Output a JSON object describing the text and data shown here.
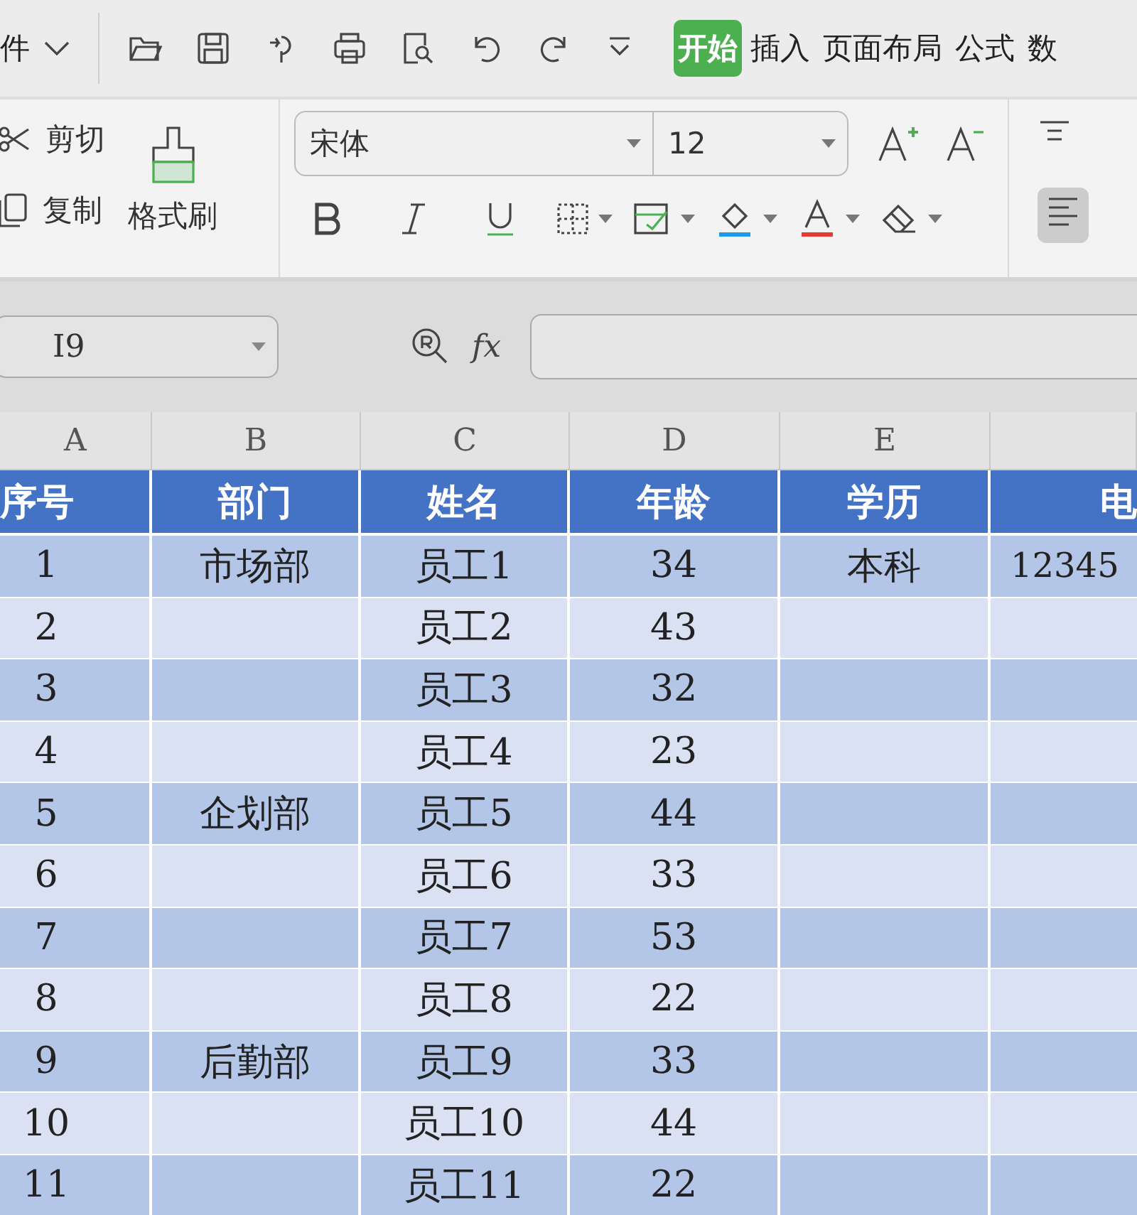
{
  "menu_bar": {
    "file_menu_fragment": "件",
    "tabs": [
      {
        "label": "开始",
        "selected": true
      },
      {
        "label": "插入",
        "selected": false
      },
      {
        "label": "页面布局",
        "selected": false
      },
      {
        "label": "公式",
        "selected": false
      },
      {
        "label": "数",
        "selected": false
      }
    ]
  },
  "ribbon": {
    "clipboard": [
      {
        "label": "剪切",
        "kind": "cut"
      },
      {
        "label": "复制",
        "kind": "copy"
      }
    ],
    "format_painter": "格式刷",
    "font_name": "宋体",
    "font_size": "12"
  },
  "formula_bar": {
    "cell_reference": "I9",
    "function_label": "fx"
  },
  "sheet": {
    "column_letters": [
      "A",
      "B",
      "C",
      "D",
      "E"
    ],
    "header": [
      "序号",
      "部门",
      "姓名",
      "年龄",
      "学历",
      "电"
    ],
    "rows": [
      [
        "1",
        "市场部",
        "员工1",
        "34",
        "本科",
        "12345"
      ],
      [
        "2",
        "",
        "员工2",
        "43",
        "",
        ""
      ],
      [
        "3",
        "",
        "员工3",
        "32",
        "",
        ""
      ],
      [
        "4",
        "",
        "员工4",
        "23",
        "",
        ""
      ],
      [
        "5",
        "企划部",
        "员工5",
        "44",
        "",
        ""
      ],
      [
        "6",
        "",
        "员工6",
        "33",
        "",
        ""
      ],
      [
        "7",
        "",
        "员工7",
        "53",
        "",
        ""
      ],
      [
        "8",
        "",
        "员工8",
        "22",
        "",
        ""
      ],
      [
        "9",
        "后勤部",
        "员工9",
        "33",
        "",
        ""
      ],
      [
        "10",
        "",
        "员工10",
        "44",
        "",
        ""
      ],
      [
        "11",
        "",
        "员工11",
        "22",
        "",
        ""
      ]
    ]
  }
}
